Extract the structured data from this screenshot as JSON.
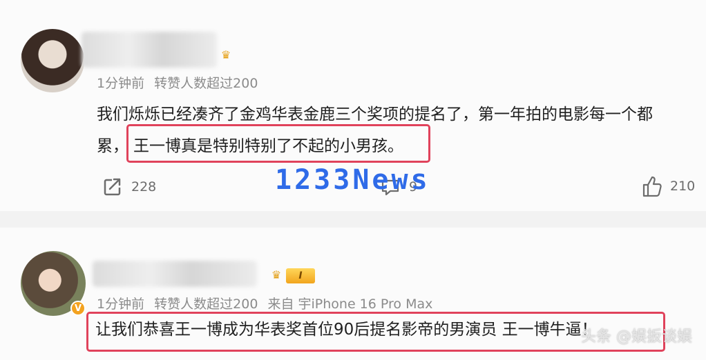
{
  "comment1": {
    "meta": [
      "1分钟前",
      "转赞人数超过200"
    ],
    "line1": "我们烁烁已经凑齐了金鸡华表金鹿三个奖项的提名了，第一年拍的电影每一个都",
    "line2_prefix": "累，",
    "line2_highlight": "王一博真是特别特别了不起的小男孩。",
    "share_count": "228",
    "comment_count": "9",
    "like_count": "210"
  },
  "comment2": {
    "rank_badge": "I",
    "vip_badge": "V",
    "meta": [
      "1分钟前",
      "转赞人数超过200",
      "来自 宇iPhone 16 Pro Max"
    ],
    "line": "让我们恭喜王一博成为华表奖首位90后提名影帝的男演员 王一博牛逼！"
  },
  "watermark": "1233News",
  "corner_watermark": "头条 @娱扳谈娱",
  "icons": {
    "share": "share-icon",
    "comment": "comment-icon",
    "like": "thumbs-up-icon",
    "crown": "crown-icon"
  },
  "colors": {
    "highlight_border": "#e0425b",
    "watermark": "#2f6be8",
    "badge_gold": "#f2a51d"
  }
}
